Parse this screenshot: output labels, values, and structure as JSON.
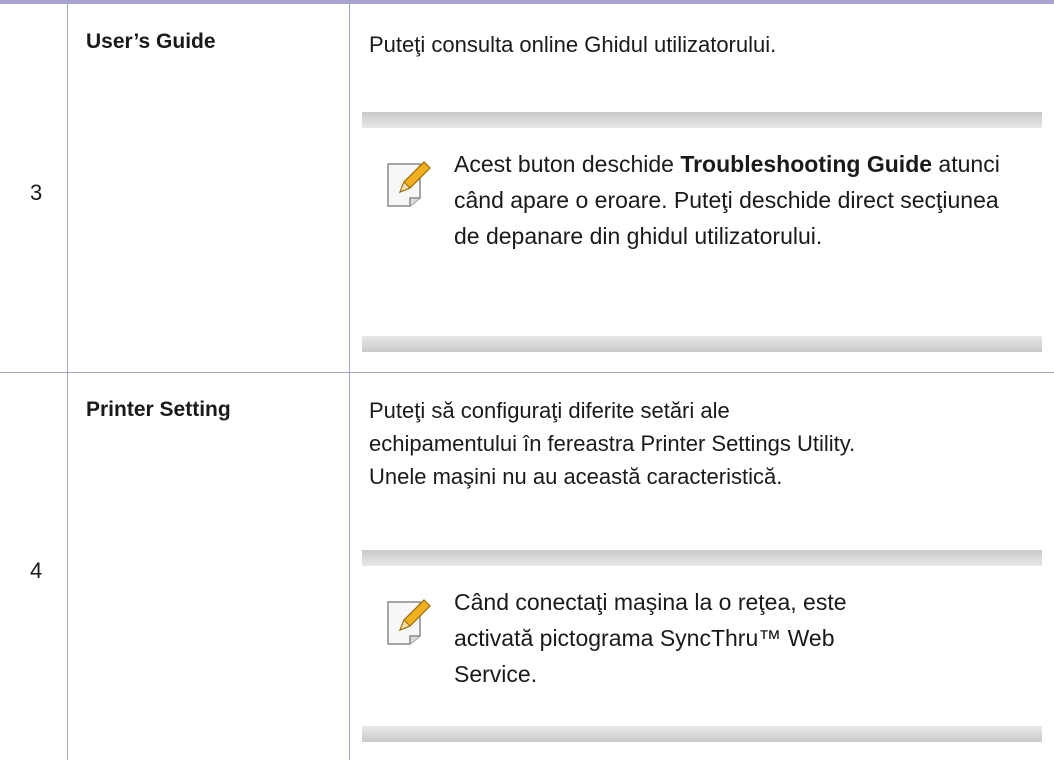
{
  "rows": [
    {
      "number": "3",
      "name": "User’s Guide",
      "description": [
        "Puteţi consulta online Ghidul utilizatorului."
      ],
      "note": {
        "text_before": "Acest buton deschide ",
        "bold": "Troubleshooting Guide",
        "text_after": " atunci când apare o eroare. Puteţi deschide direct secţiunea de depanare din ghidul utilizatorului."
      }
    },
    {
      "number": "4",
      "name": "Printer Setting",
      "description": [
        "Puteţi să configuraţi diferite setări ale",
        "echipamentului în fereastra Printer Settings Utility.",
        "Unele maşini nu au această caracteristică."
      ],
      "note": {
        "text": "Când conectaţi maşina la o reţea, este activată pictograma SyncThru™ Web Service."
      }
    }
  ],
  "colors": {
    "rule": "#a7a3cf",
    "note_band": "#d6d6d6",
    "icon_pencil": "#f0b020"
  }
}
